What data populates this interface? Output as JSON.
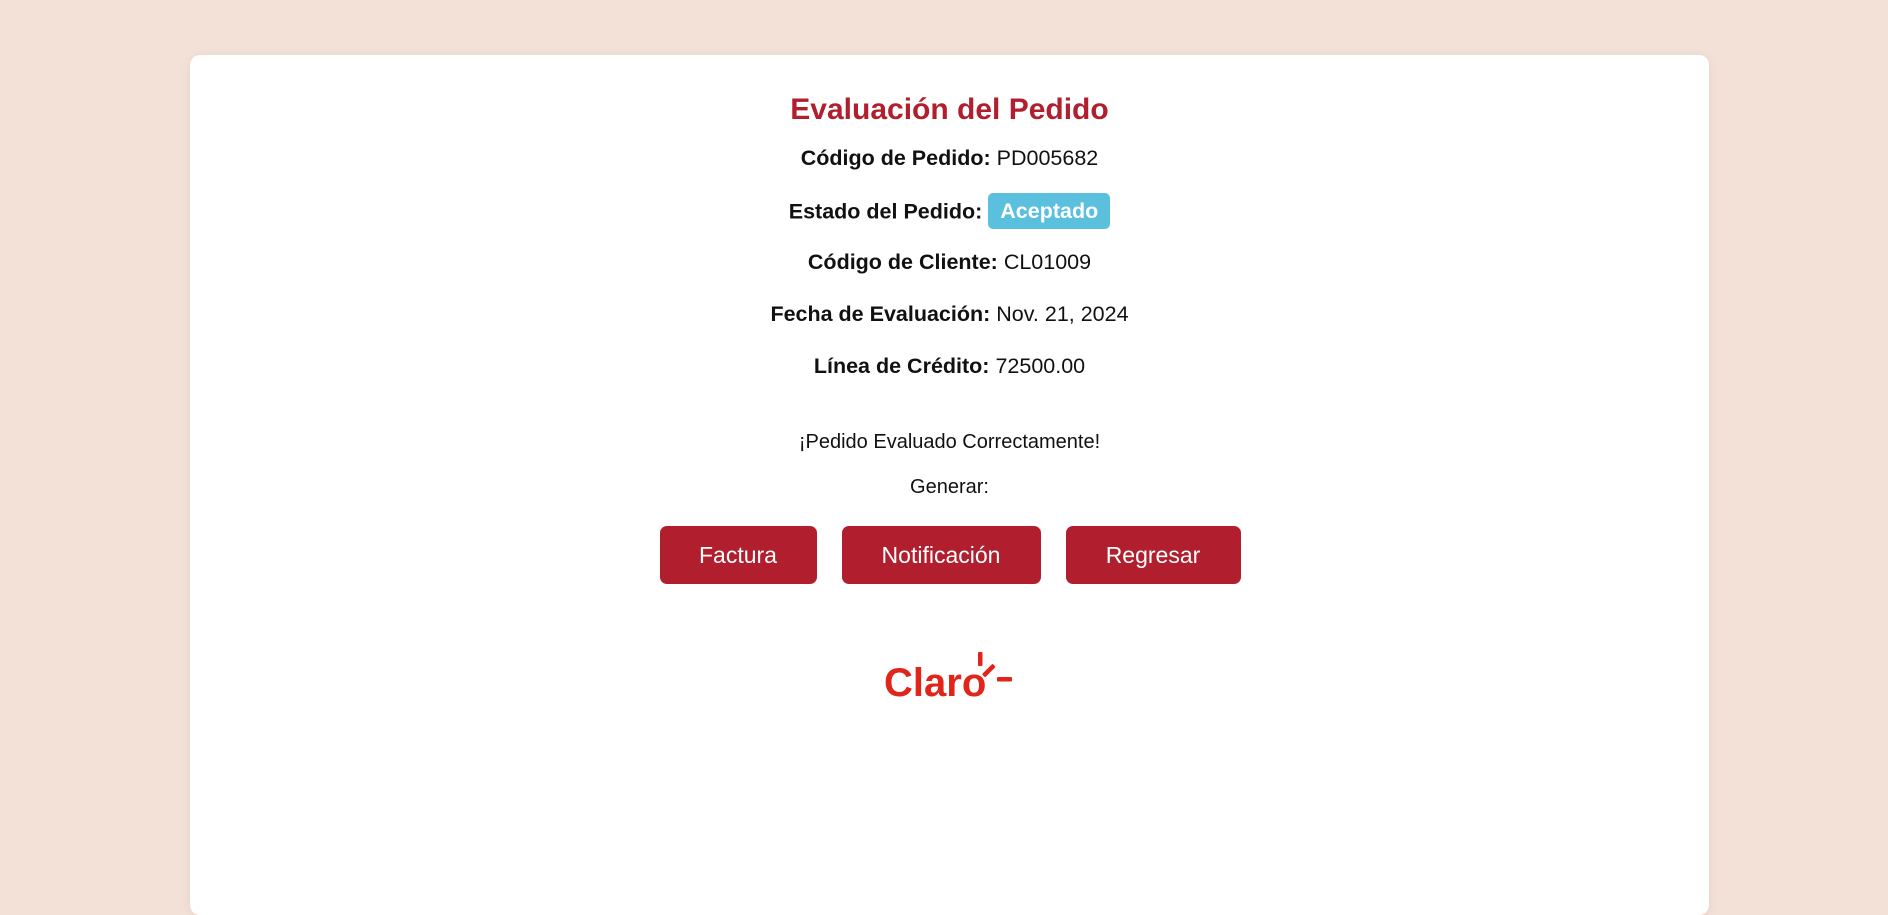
{
  "page": {
    "title": "Evaluación del Pedido"
  },
  "fields": {
    "order_code_label": "Código de Pedido:",
    "order_code_value": "PD005682",
    "order_status_label": "Estado del Pedido:",
    "order_status_value": "Aceptado",
    "client_code_label": "Código de Cliente:",
    "client_code_value": "CL01009",
    "eval_date_label": "Fecha de Evaluación:",
    "eval_date_value": "Nov. 21, 2024",
    "credit_line_label": "Línea de Crédito:",
    "credit_line_value": "72500.00"
  },
  "message": "¡Pedido Evaluado Correctamente!",
  "generate_label": "Generar:",
  "buttons": {
    "invoice": "Factura",
    "notification": "Notificación",
    "back": "Regresar"
  },
  "logo": {
    "text": "Claro",
    "icon": "claro-logo-icon"
  },
  "colors": {
    "background": "#f3e0d6",
    "accent": "#b11f2e",
    "status_badge": "#5bc0de",
    "logo": "#e1251b"
  }
}
